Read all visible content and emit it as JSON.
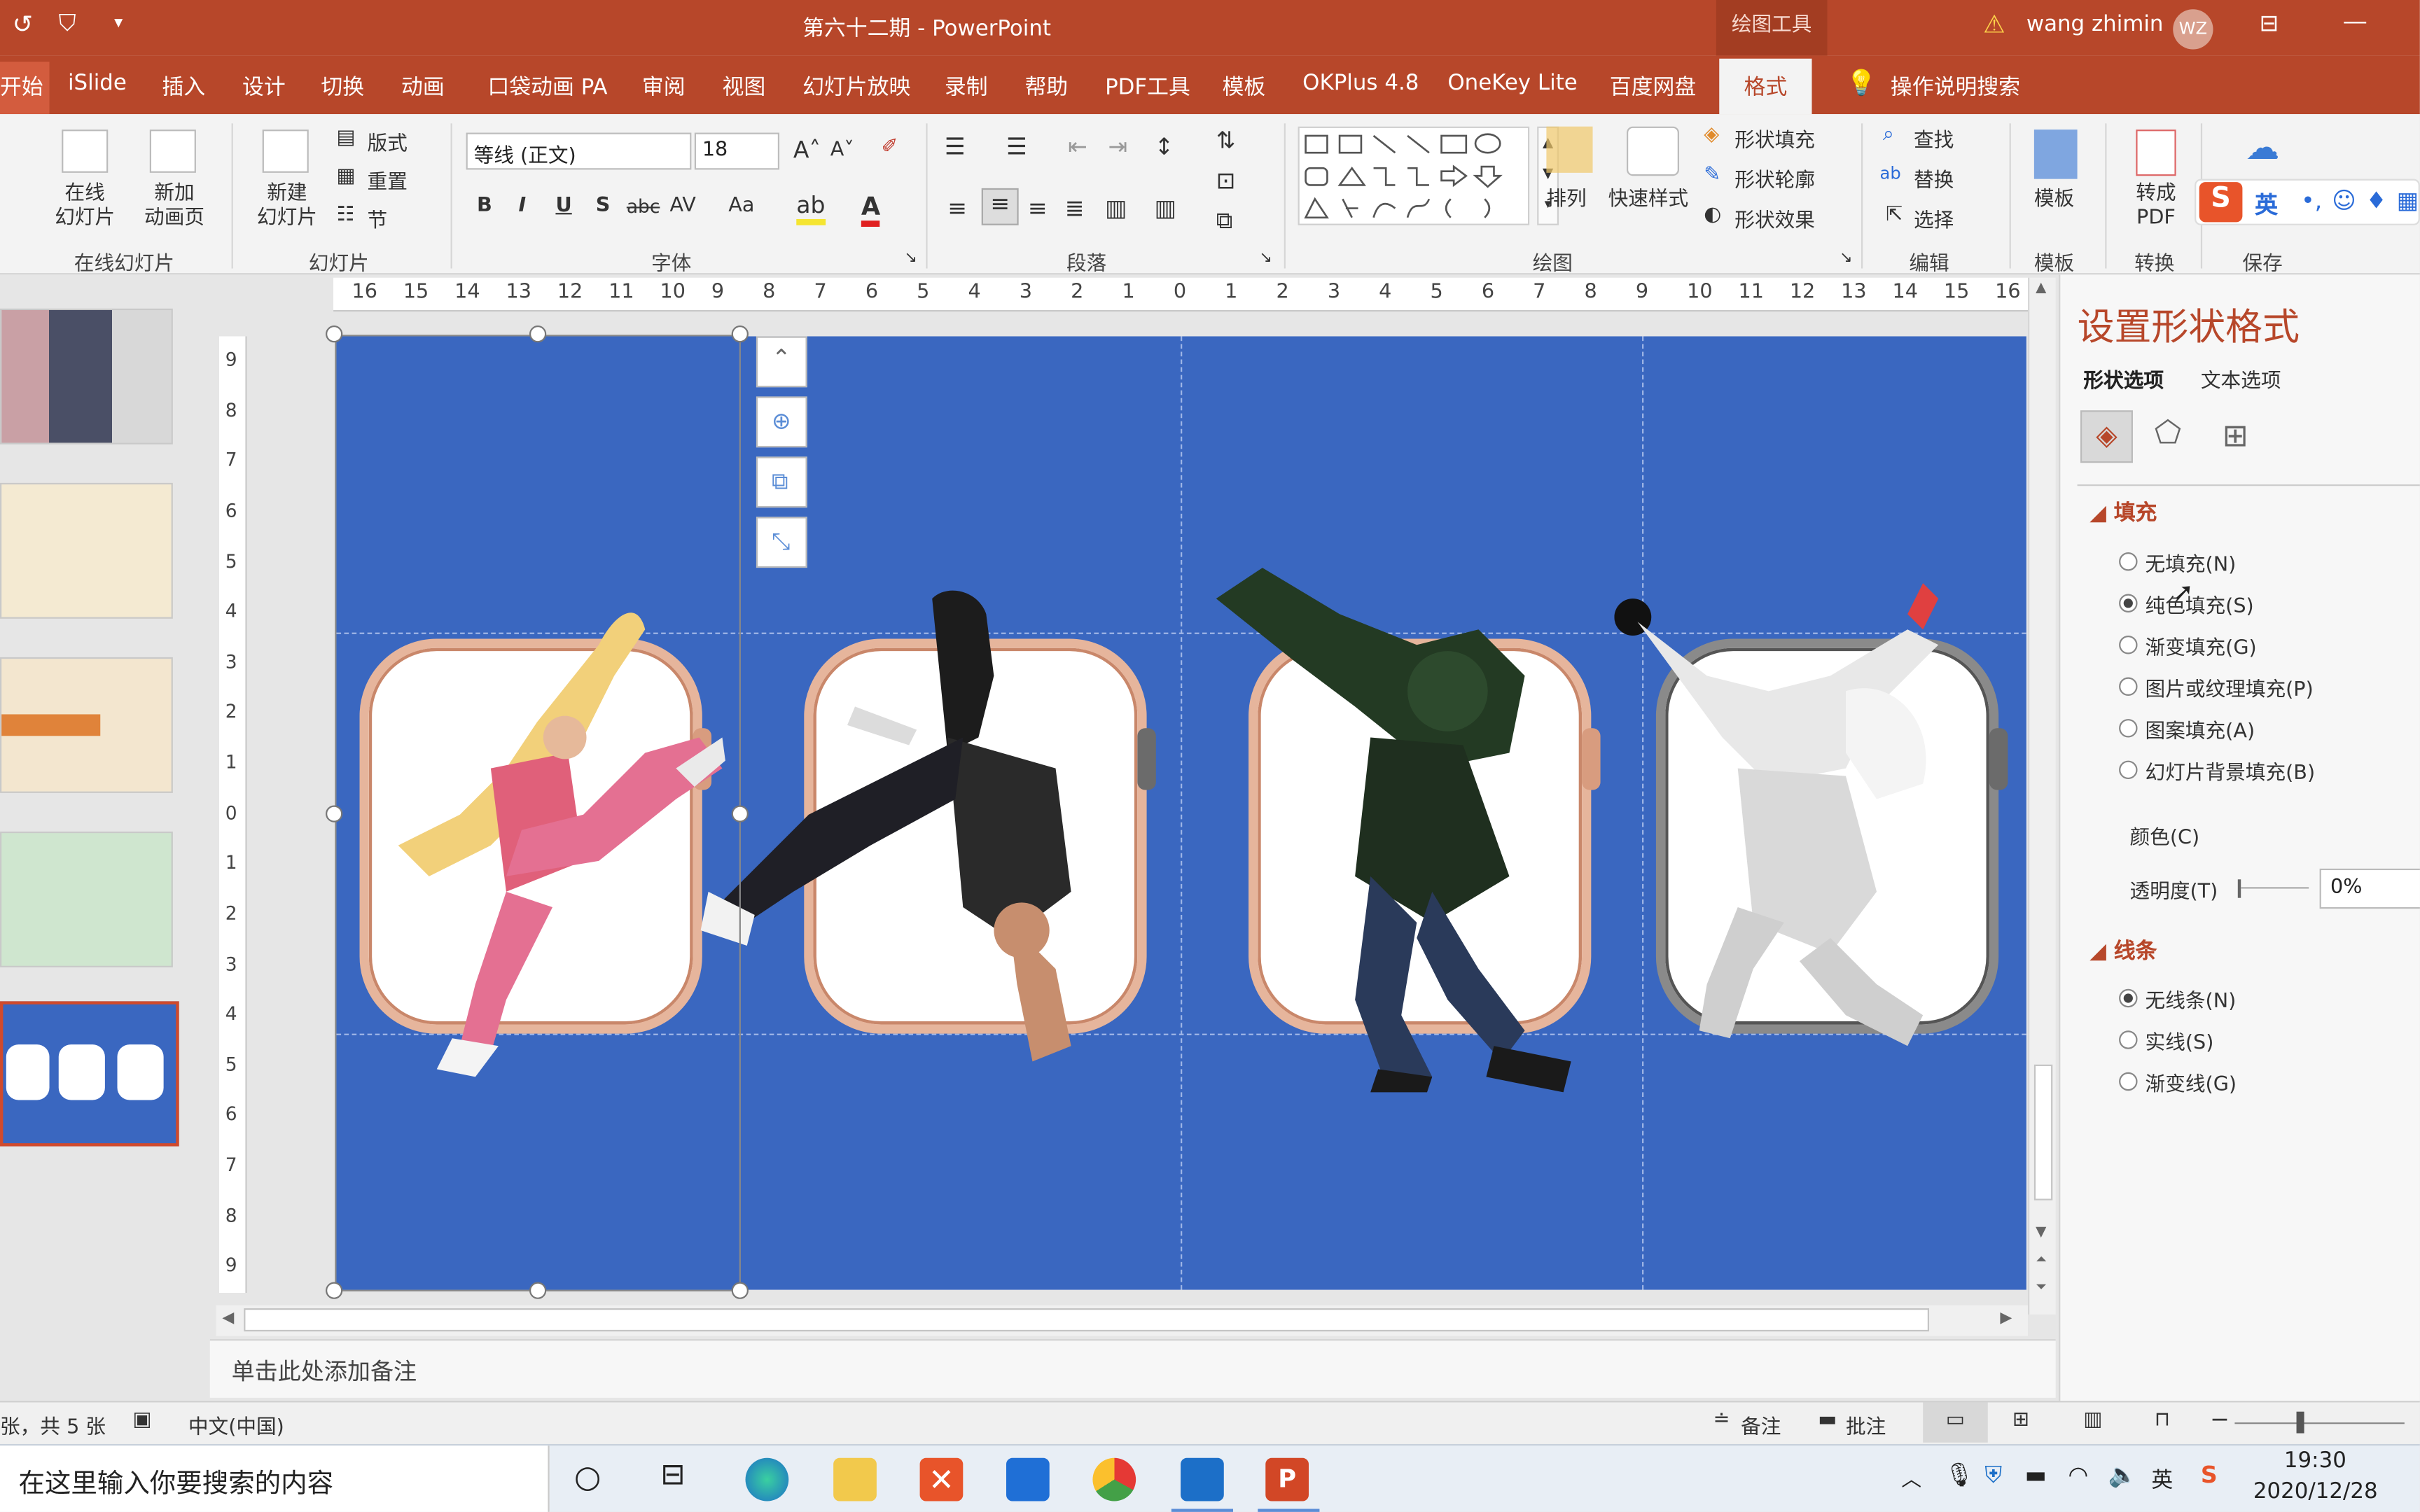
{
  "titlebar": {
    "doc_title": "第六十二期 - PowerPoint",
    "drawing_tools": "绘图工具",
    "user_name": "wang zhimin",
    "user_initials": "WZ",
    "quick_access": [
      "undo-icon",
      "slideshow-icon",
      "customize-icon"
    ]
  },
  "menu": {
    "tabs": [
      "开始",
      "iSlide",
      "插入",
      "设计",
      "切换",
      "动画",
      "口袋动画 PA",
      "审阅",
      "视图",
      "幻灯片放映",
      "录制",
      "帮助",
      "PDF工具",
      "模板",
      "OKPlus 4.8",
      "OneKey Lite",
      "百度网盘",
      "格式"
    ],
    "active_tab": "格式",
    "tell_me": "操作说明搜索"
  },
  "ribbon": {
    "online": {
      "online_slides": "在线\n幻灯片",
      "new_anim_page": "新加\n动画页",
      "group": "在线幻灯片"
    },
    "slides": {
      "new_slide": "新建\n幻灯片",
      "layout": "版式",
      "reset": "重置",
      "section": "节",
      "group": "幻灯片"
    },
    "font": {
      "font_name": "等线 (正文)",
      "font_size": "18",
      "bold": "B",
      "italic": "I",
      "underline": "U",
      "shadow": "S",
      "strike": "abc",
      "spacing": "AV",
      "case": "Aa",
      "group": "字体"
    },
    "paragraph": {
      "group": "段落"
    },
    "drawing": {
      "arrange": "排列",
      "quick_styles": "快速样式",
      "shape_fill": "形状填充",
      "shape_outline": "形状轮廓",
      "shape_effects": "形状效果",
      "group": "绘图"
    },
    "editing": {
      "find": "查找",
      "replace": "替换",
      "select": "选择",
      "group": "编辑"
    },
    "template": {
      "template": "模板",
      "group": "模板"
    },
    "convert": {
      "to_pdf": "转成\nPDF",
      "group": "转换"
    },
    "save": {
      "group": "保存"
    },
    "ime_label": "英"
  },
  "rulers": {
    "h_ticks": [
      "16",
      "15",
      "14",
      "13",
      "12",
      "11",
      "10",
      "9",
      "8",
      "7",
      "6",
      "5",
      "4",
      "3",
      "2",
      "1",
      "0",
      "1",
      "2",
      "3",
      "4",
      "5",
      "6",
      "7",
      "8",
      "9",
      "10",
      "11",
      "12",
      "13",
      "14",
      "15",
      "16"
    ],
    "v_ticks": [
      "9",
      "8",
      "7",
      "6",
      "5",
      "4",
      "3",
      "2",
      "1",
      "0",
      "1",
      "2",
      "3",
      "4",
      "5",
      "6",
      "7",
      "8",
      "9"
    ]
  },
  "thumbnails": {
    "selected_index": 5,
    "count": 5,
    "colors": [
      "#c9a0a5",
      "#f4ead2",
      "#f3e6cf",
      "#cfe6cf",
      "#3a67c0"
    ]
  },
  "slide": {
    "background_color": "#3a67c0",
    "images": [
      "dancer-pink-image",
      "dancer-handstand-image",
      "dancer-green-image",
      "dancer-white-image"
    ]
  },
  "pane": {
    "title": "设置形状格式",
    "tab_shape": "形状选项",
    "tab_text": "文本选项",
    "fill_section": "填充",
    "fill_options": [
      "无填充(N)",
      "纯色填充(S)",
      "渐变填充(G)",
      "图片或纹理填充(P)",
      "图案填充(A)",
      "幻灯片背景填充(B)"
    ],
    "fill_selected": 1,
    "color_label": "颜色(C)",
    "transparency_label": "透明度(T)",
    "transparency_value": "0%",
    "line_section": "线条",
    "line_options": [
      "无线条(N)",
      "实线(S)",
      "渐变线(G)"
    ],
    "line_selected": 0
  },
  "notes": {
    "placeholder": "单击此处添加备注"
  },
  "status": {
    "slide_info": "张，共 5 张",
    "language": "中文(中国)",
    "notes_btn": "备注",
    "comments_btn": "批注"
  },
  "taskbar": {
    "search_placeholder": "在这里输入你要搜索的内容",
    "time": "19:30",
    "date": "2020/12/28",
    "ime": "英"
  }
}
